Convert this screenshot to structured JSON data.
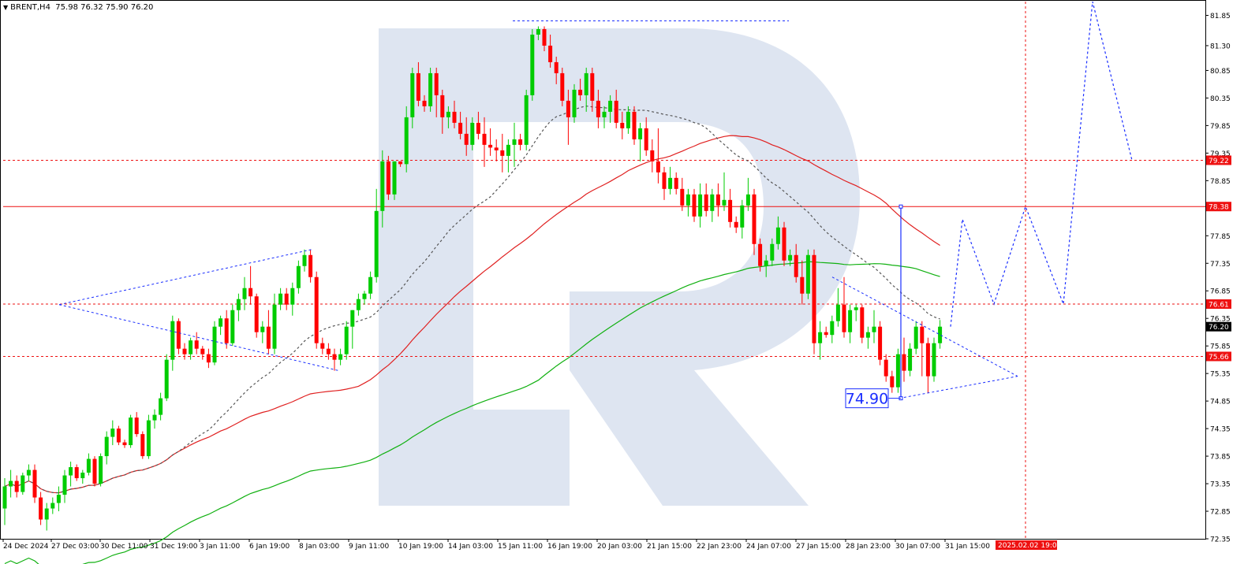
{
  "header": {
    "arrow_glyph": "▼",
    "symbol_timeframe": "BRENT,H4",
    "ohlc": "75.98 76.32 75.90 76.20"
  },
  "colors": {
    "bull": "#00cc00",
    "bear": "#ff0000",
    "level_line": "#ee1111",
    "forecast": "#1a2eff",
    "ma_red": "#e02020",
    "ma_green": "#10b010",
    "ma_grey": "#555555",
    "watermark": "#d8e1ef",
    "current_price_bg": "#000000"
  },
  "chart_data": {
    "type": "candlestick",
    "symbol": "BRENT",
    "timeframe": "H4",
    "ylim": [
      72.35,
      82.1
    ],
    "y_ticks": [
      81.85,
      81.3,
      80.85,
      80.35,
      79.85,
      79.35,
      78.85,
      78.35,
      77.85,
      77.35,
      76.85,
      76.35,
      75.85,
      75.35,
      74.85,
      74.35,
      73.85,
      73.35,
      72.85,
      72.35
    ],
    "x_ticks": [
      "24 Dec 2024",
      "27 Dec 03:00",
      "30 Dec 11:00",
      "31 Dec 19:00",
      "3 Jan 11:00",
      "6 Jan 19:00",
      "8 Jan 03:00",
      "9 Jan 11:00",
      "10 Jan 19:00",
      "14 Jan 03:00",
      "15 Jan 11:00",
      "16 Jan 19:00",
      "20 Jan 03:00",
      "21 Jan 15:00",
      "22 Jan 23:00",
      "24 Jan 07:00",
      "27 Jan 15:00",
      "28 Jan 23:00",
      "30 Jan 07:00",
      "31 Jan 15:00"
    ],
    "highlighted_x_label": "2025.02.02 19:00",
    "horizontal_levels": [
      {
        "value": 79.22,
        "label": "79.22",
        "style": "dashed"
      },
      {
        "value": 78.38,
        "label": "78.38",
        "style": "solid"
      },
      {
        "value": 76.61,
        "label": "76.61",
        "style": "dashed"
      },
      {
        "value": 75.66,
        "label": "75.66",
        "style": "dashed"
      }
    ],
    "current_price": {
      "value": 76.2,
      "label": "76.20"
    },
    "target_annotation": {
      "label": "74.90",
      "value": 74.9,
      "top_value": 78.38
    },
    "forecast_path": [
      76.2,
      78.15,
      76.61,
      78.38,
      76.61,
      82.1,
      79.22
    ],
    "ohlc": [
      [
        72.9,
        73.45,
        72.6,
        73.3
      ],
      [
        73.3,
        73.6,
        73.1,
        73.4
      ],
      [
        73.4,
        73.5,
        73.1,
        73.2
      ],
      [
        73.2,
        73.55,
        73.15,
        73.5
      ],
      [
        73.5,
        73.7,
        73.4,
        73.6
      ],
      [
        73.6,
        73.7,
        73.0,
        73.1
      ],
      [
        73.1,
        73.2,
        72.6,
        72.7
      ],
      [
        72.7,
        73.0,
        72.5,
        72.9
      ],
      [
        72.9,
        73.1,
        72.8,
        73.0
      ],
      [
        73.0,
        73.3,
        72.85,
        73.15
      ],
      [
        73.15,
        73.6,
        73.0,
        73.5
      ],
      [
        73.5,
        73.75,
        73.3,
        73.65
      ],
      [
        73.65,
        73.7,
        73.4,
        73.45
      ],
      [
        73.45,
        73.6,
        73.35,
        73.55
      ],
      [
        73.55,
        73.9,
        73.5,
        73.8
      ],
      [
        73.8,
        73.85,
        73.3,
        73.35
      ],
      [
        73.35,
        73.9,
        73.3,
        73.85
      ],
      [
        73.85,
        74.3,
        73.7,
        74.2
      ],
      [
        74.2,
        74.5,
        74.05,
        74.35
      ],
      [
        74.35,
        74.4,
        74.05,
        74.1
      ],
      [
        74.1,
        74.15,
        74.0,
        74.05
      ],
      [
        74.05,
        74.6,
        74.0,
        74.55
      ],
      [
        74.55,
        74.65,
        74.2,
        74.25
      ],
      [
        74.25,
        74.3,
        73.8,
        73.85
      ],
      [
        73.85,
        74.6,
        73.8,
        74.5
      ],
      [
        74.5,
        74.7,
        74.35,
        74.6
      ],
      [
        74.6,
        75.0,
        74.5,
        74.9
      ],
      [
        74.9,
        75.7,
        74.85,
        75.6
      ],
      [
        75.6,
        76.4,
        75.4,
        76.3
      ],
      [
        76.3,
        76.35,
        75.7,
        75.8
      ],
      [
        75.8,
        75.9,
        75.6,
        75.7
      ],
      [
        75.7,
        76.0,
        75.6,
        75.95
      ],
      [
        75.95,
        76.1,
        75.7,
        75.8
      ],
      [
        75.8,
        75.85,
        75.6,
        75.7
      ],
      [
        75.7,
        75.8,
        75.45,
        75.55
      ],
      [
        75.55,
        76.3,
        75.5,
        76.2
      ],
      [
        76.2,
        76.4,
        76.05,
        76.35
      ],
      [
        76.35,
        76.5,
        75.8,
        75.9
      ],
      [
        75.9,
        76.6,
        75.85,
        76.5
      ],
      [
        76.5,
        76.8,
        76.3,
        76.7
      ],
      [
        76.7,
        77.1,
        76.5,
        76.9
      ],
      [
        76.9,
        77.3,
        76.6,
        76.75
      ],
      [
        76.75,
        76.8,
        76.0,
        76.1
      ],
      [
        76.1,
        76.3,
        75.9,
        76.2
      ],
      [
        76.2,
        76.5,
        75.7,
        75.8
      ],
      [
        75.8,
        76.8,
        75.7,
        76.6
      ],
      [
        76.6,
        76.9,
        76.5,
        76.8
      ],
      [
        76.8,
        76.9,
        76.5,
        76.6
      ],
      [
        76.6,
        77.0,
        76.4,
        76.9
      ],
      [
        76.9,
        77.4,
        76.8,
        77.3
      ],
      [
        77.3,
        77.6,
        77.2,
        77.5
      ],
      [
        77.5,
        77.6,
        77.0,
        77.1
      ],
      [
        77.1,
        77.2,
        75.8,
        75.9
      ],
      [
        75.9,
        76.0,
        75.7,
        75.8
      ],
      [
        75.8,
        75.9,
        75.6,
        75.7
      ],
      [
        75.7,
        75.8,
        75.4,
        75.6
      ],
      [
        75.6,
        75.8,
        75.5,
        75.7
      ],
      [
        75.7,
        76.3,
        75.6,
        76.2
      ],
      [
        76.2,
        76.5,
        75.8,
        76.5
      ],
      [
        76.5,
        76.8,
        76.4,
        76.7
      ],
      [
        76.7,
        76.85,
        76.6,
        76.8
      ],
      [
        76.8,
        77.2,
        76.7,
        77.1
      ],
      [
        77.1,
        78.7,
        77.0,
        78.3
      ],
      [
        78.3,
        79.4,
        78.0,
        79.2
      ],
      [
        79.2,
        79.3,
        78.5,
        78.6
      ],
      [
        78.6,
        79.2,
        78.5,
        79.2
      ],
      [
        79.2,
        79.2,
        79.1,
        79.15
      ],
      [
        79.15,
        80.2,
        79.0,
        80.0
      ],
      [
        80.0,
        80.9,
        79.8,
        80.8
      ],
      [
        80.8,
        81.0,
        80.2,
        80.3
      ],
      [
        80.3,
        80.4,
        80.1,
        80.2
      ],
      [
        80.2,
        80.9,
        80.1,
        80.8
      ],
      [
        80.8,
        80.9,
        80.0,
        80.4
      ],
      [
        80.4,
        80.5,
        79.7,
        80.0
      ],
      [
        80.0,
        80.2,
        79.8,
        80.1
      ],
      [
        80.1,
        80.3,
        79.8,
        79.9
      ],
      [
        79.9,
        80.1,
        79.6,
        79.7
      ],
      [
        79.7,
        80.0,
        79.3,
        79.5
      ],
      [
        79.5,
        80.0,
        79.4,
        79.9
      ],
      [
        79.9,
        80.1,
        79.6,
        79.7
      ],
      [
        79.7,
        80.0,
        79.1,
        79.5
      ],
      [
        79.5,
        79.8,
        79.3,
        79.45
      ],
      [
        79.45,
        79.6,
        79.2,
        79.4
      ],
      [
        79.4,
        79.7,
        79.0,
        79.3
      ],
      [
        79.3,
        79.6,
        79.0,
        79.5
      ],
      [
        79.5,
        79.9,
        79.1,
        79.6
      ],
      [
        79.6,
        79.7,
        79.4,
        79.5
      ],
      [
        79.5,
        80.5,
        79.4,
        80.4
      ],
      [
        80.4,
        81.6,
        80.3,
        81.5
      ],
      [
        81.5,
        81.65,
        81.4,
        81.6
      ],
      [
        81.6,
        81.65,
        81.2,
        81.3
      ],
      [
        81.3,
        81.5,
        80.9,
        81.0
      ],
      [
        81.0,
        81.1,
        80.6,
        80.8
      ],
      [
        80.8,
        80.9,
        80.2,
        80.3
      ],
      [
        80.3,
        80.5,
        79.5,
        80.0
      ],
      [
        80.0,
        80.6,
        79.9,
        80.5
      ],
      [
        80.5,
        80.7,
        80.3,
        80.4
      ],
      [
        80.4,
        80.9,
        80.1,
        80.8
      ],
      [
        80.8,
        80.9,
        80.1,
        80.3
      ],
      [
        80.3,
        80.5,
        79.8,
        80.0
      ],
      [
        80.0,
        80.2,
        79.8,
        80.1
      ],
      [
        80.1,
        80.4,
        79.9,
        80.3
      ],
      [
        80.3,
        80.5,
        79.8,
        79.9
      ],
      [
        79.9,
        80.1,
        79.6,
        79.8
      ],
      [
        79.8,
        80.2,
        79.7,
        80.1
      ],
      [
        80.1,
        80.2,
        79.5,
        79.6
      ],
      [
        79.6,
        79.9,
        79.2,
        79.8
      ],
      [
        79.8,
        80.0,
        79.3,
        79.4
      ],
      [
        79.4,
        79.6,
        79.0,
        79.2
      ],
      [
        79.2,
        79.8,
        78.8,
        79.0
      ],
      [
        79.0,
        79.1,
        78.5,
        78.7
      ],
      [
        78.7,
        79.1,
        78.6,
        78.9
      ],
      [
        78.9,
        79.0,
        78.6,
        78.7
      ],
      [
        78.7,
        78.9,
        78.3,
        78.4
      ],
      [
        78.4,
        78.7,
        78.2,
        78.6
      ],
      [
        78.6,
        78.7,
        78.1,
        78.2
      ],
      [
        78.2,
        78.8,
        78.0,
        78.6
      ],
      [
        78.6,
        78.8,
        78.2,
        78.3
      ],
      [
        78.3,
        78.7,
        78.1,
        78.6
      ],
      [
        78.6,
        78.8,
        78.2,
        78.4
      ],
      [
        78.4,
        79.0,
        78.3,
        78.5
      ],
      [
        78.5,
        78.7,
        78.0,
        78.1
      ],
      [
        78.1,
        78.2,
        77.9,
        78.0
      ],
      [
        78.0,
        78.5,
        77.8,
        78.4
      ],
      [
        78.4,
        78.9,
        78.3,
        78.6
      ],
      [
        78.6,
        78.7,
        77.5,
        77.7
      ],
      [
        77.7,
        77.8,
        77.2,
        77.3
      ],
      [
        77.3,
        77.5,
        77.1,
        77.4
      ],
      [
        77.4,
        77.8,
        77.3,
        77.7
      ],
      [
        77.7,
        78.2,
        77.6,
        78.0
      ],
      [
        78.0,
        78.1,
        77.3,
        77.4
      ],
      [
        77.4,
        77.6,
        77.3,
        77.5
      ],
      [
        77.5,
        77.7,
        77.0,
        77.1
      ],
      [
        77.1,
        77.4,
        76.6,
        76.8
      ],
      [
        76.8,
        77.6,
        76.7,
        77.5
      ],
      [
        77.5,
        77.6,
        75.7,
        75.9
      ],
      [
        75.9,
        76.3,
        75.6,
        76.1
      ],
      [
        76.1,
        76.2,
        76.0,
        76.05
      ],
      [
        76.05,
        76.4,
        75.9,
        76.3
      ],
      [
        76.3,
        76.9,
        76.2,
        76.6
      ],
      [
        76.6,
        77.1,
        76.0,
        76.1
      ],
      [
        76.1,
        76.6,
        75.9,
        76.5
      ],
      [
        76.5,
        76.6,
        76.3,
        76.55
      ],
      [
        76.55,
        76.6,
        75.9,
        76.0
      ],
      [
        76.0,
        76.2,
        75.8,
        76.1
      ],
      [
        76.1,
        76.5,
        75.9,
        76.2
      ],
      [
        76.2,
        76.3,
        75.5,
        75.6
      ],
      [
        75.6,
        75.7,
        75.2,
        75.3
      ],
      [
        75.3,
        75.4,
        75.0,
        75.1
      ],
      [
        75.1,
        75.8,
        75.0,
        75.7
      ],
      [
        75.7,
        76.0,
        75.2,
        75.4
      ],
      [
        75.4,
        75.9,
        75.3,
        75.8
      ],
      [
        75.8,
        76.3,
        75.7,
        76.2
      ],
      [
        76.2,
        76.3,
        75.3,
        75.9
      ],
      [
        75.9,
        76.0,
        75.0,
        75.3
      ],
      [
        75.3,
        76.0,
        75.2,
        75.9
      ],
      [
        75.9,
        76.32,
        75.8,
        76.2
      ]
    ]
  }
}
